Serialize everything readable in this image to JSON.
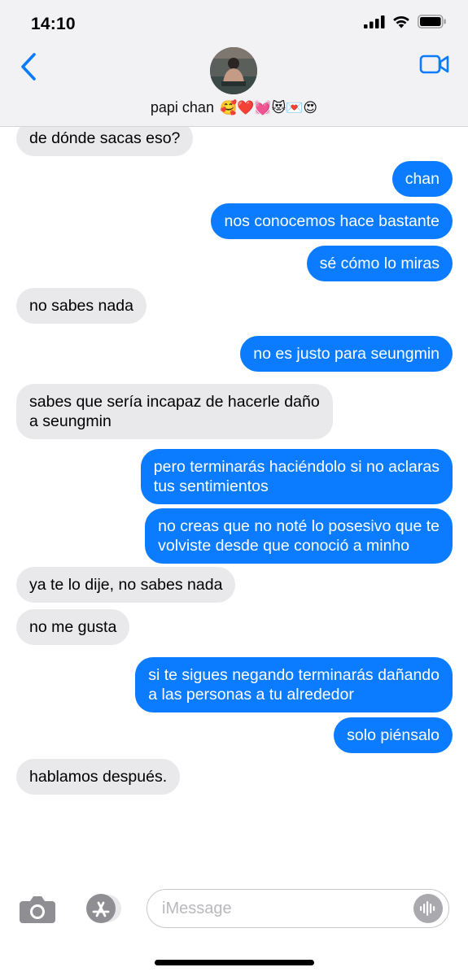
{
  "status_bar": {
    "time": "14:10"
  },
  "header": {
    "contact_name": "papi chan",
    "contact_emojis": "🥰❤️💓😻💌😍"
  },
  "messages": [
    {
      "side": "in",
      "text": "de dónde sacas eso?"
    },
    {
      "side": "out",
      "text": "chan"
    },
    {
      "side": "out",
      "text": "nos conocemos hace bastante"
    },
    {
      "side": "out",
      "text": "sé cómo lo miras"
    },
    {
      "side": "in",
      "text": "no sabes nada"
    },
    {
      "side": "out",
      "text": "no es justo para seungmin"
    },
    {
      "side": "in",
      "text": "sabes que sería incapaz de hacerle daño\na seungmin"
    },
    {
      "side": "out",
      "text": "pero terminarás haciéndolo si no aclaras\ntus sentimientos"
    },
    {
      "side": "out",
      "text": "no creas que no noté lo posesivo que te\nvolviste desde que conoció a minho"
    },
    {
      "side": "in",
      "text": "ya te lo dije, no sabes nada"
    },
    {
      "side": "in",
      "text": "no me gusta"
    },
    {
      "side": "out",
      "text": "si te sigues negando terminarás dañando\na las personas a tu alrededor"
    },
    {
      "side": "out",
      "text": "solo piénsalo"
    },
    {
      "side": "in",
      "text": "hablamos después."
    }
  ],
  "input": {
    "placeholder": "iMessage"
  },
  "colors": {
    "outgoing": "#0b7cff",
    "incoming": "#e9e9eb",
    "accent": "#0a7aff"
  }
}
